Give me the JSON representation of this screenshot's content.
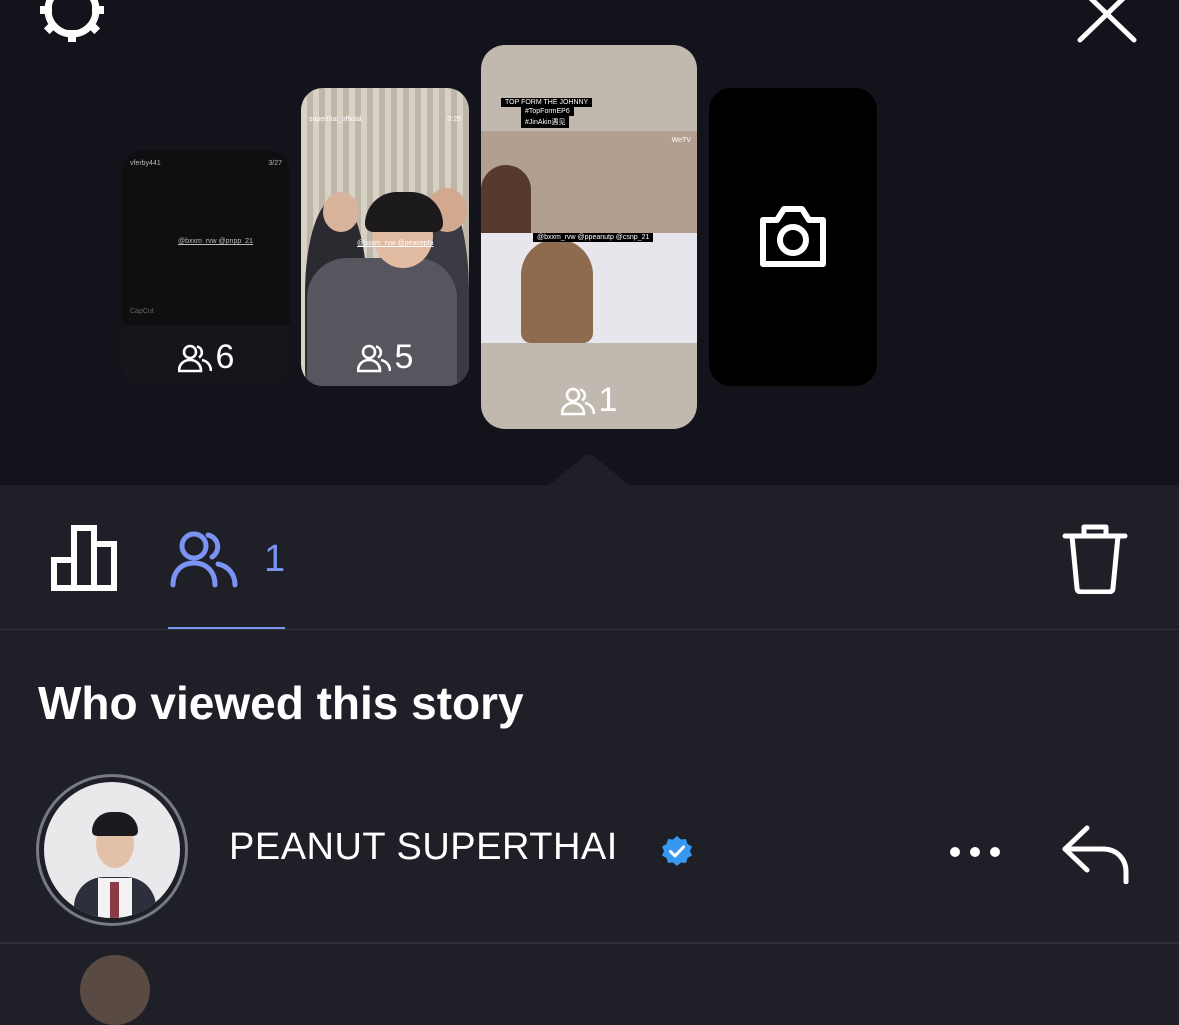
{
  "stories": [
    {
      "viewers": "6",
      "username": "vferby441",
      "time": "3/27",
      "mention": "@bxxm_rvw @pnpp_21",
      "watermark": "CapCut"
    },
    {
      "viewers": "5",
      "username": "superthai_official",
      "time": "0:25",
      "mention": "@bxxm_rvw @peacepfa"
    },
    {
      "viewers": "1",
      "captions": [
        "TOP FORM THE JOHNNY",
        "#TopFormEP6",
        "#JinAkin遇见"
      ],
      "channel": "WeTV",
      "mention": "@bxxm_rvw @ppeanutp @csnp_21"
    },
    {
      "type": "camera"
    }
  ],
  "tabs": {
    "viewers_count": "1"
  },
  "section_title": "Who viewed this story",
  "viewers": [
    {
      "name": "PEANUT SUPERTHAI",
      "verified": true
    }
  ],
  "colors": {
    "accent": "#7b93f2",
    "verified": "#3897f0",
    "background": "#1f2027",
    "top_background": "#12131b"
  },
  "icons": [
    "settings-icon",
    "close-icon",
    "people-icon",
    "camera-icon",
    "bar-chart-icon",
    "trash-icon",
    "verified-badge-icon",
    "more-icon",
    "reply-icon"
  ]
}
